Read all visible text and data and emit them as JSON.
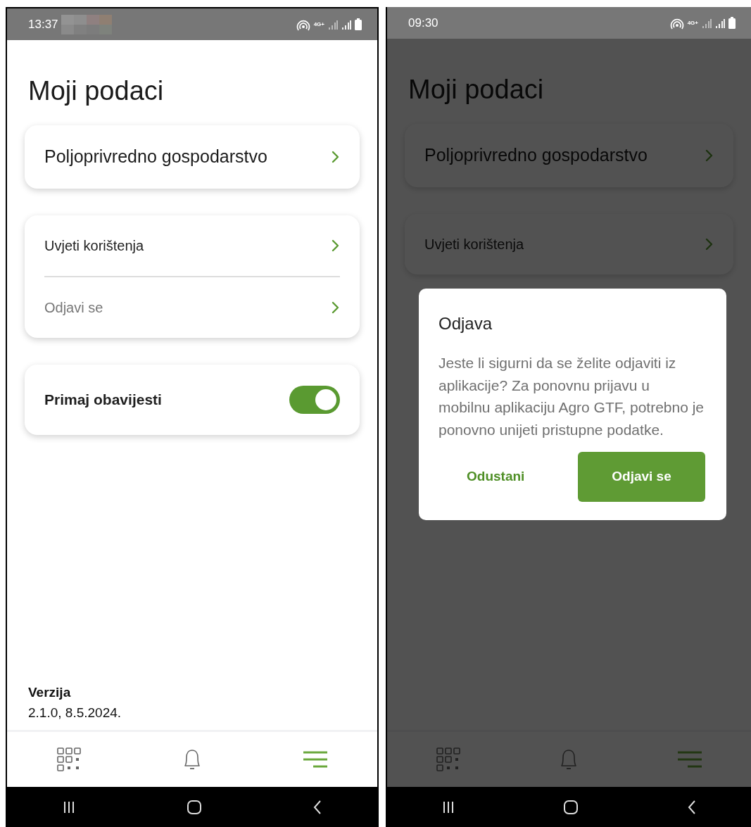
{
  "screens": [
    {
      "status_bar": {
        "time": "13:37",
        "masked": true,
        "network": "4G+"
      },
      "title": "Moji podaci",
      "groups": [
        {
          "items": [
            {
              "kind": "heading-link",
              "label": "Poljoprivredno gospodarstvo",
              "dimmed": false
            }
          ]
        },
        {
          "items": [
            {
              "kind": "link",
              "label": "Uvjeti korištenja",
              "dimmed": false
            },
            {
              "kind": "link",
              "label": "Odjavi se",
              "dimmed": true
            }
          ]
        },
        {
          "items": [
            {
              "kind": "toggle",
              "label": "Primaj obavijesti",
              "on": true
            }
          ]
        }
      ],
      "version": {
        "label": "Verzija",
        "value": "2.1.0, 8.5.2024."
      },
      "bottom_nav": [
        {
          "kind": "grid",
          "selected": false
        },
        {
          "kind": "bell",
          "selected": false
        },
        {
          "kind": "menu",
          "selected": true
        }
      ]
    },
    {
      "status_bar": {
        "time": "09:30",
        "network": "4G+"
      },
      "title": "Moji podaci",
      "groups": [
        {
          "items": [
            {
              "kind": "heading-link",
              "label": "Poljoprivredno gospodarstvo",
              "dimmed": false
            }
          ]
        },
        {
          "items": [
            {
              "kind": "link",
              "label": "Uvjeti korištenja",
              "dimmed": false
            }
          ]
        }
      ],
      "bottom_nav": [
        {
          "kind": "grid",
          "selected": false
        },
        {
          "kind": "bell",
          "selected": false
        },
        {
          "kind": "menu",
          "selected": true
        }
      ],
      "dialog": {
        "title": "Odjava",
        "message": "Jeste li sigurni da se želite odjaviti iz aplikacije? Za ponovnu prijavu u mobilnu aplikaciju Agro GTF, potrebno je ponovno unijeti pristupne podatke.",
        "buttons": [
          {
            "kind": "text",
            "label": "Odustani"
          },
          {
            "kind": "filled",
            "label": "Odjavi se"
          }
        ]
      }
    }
  ]
}
